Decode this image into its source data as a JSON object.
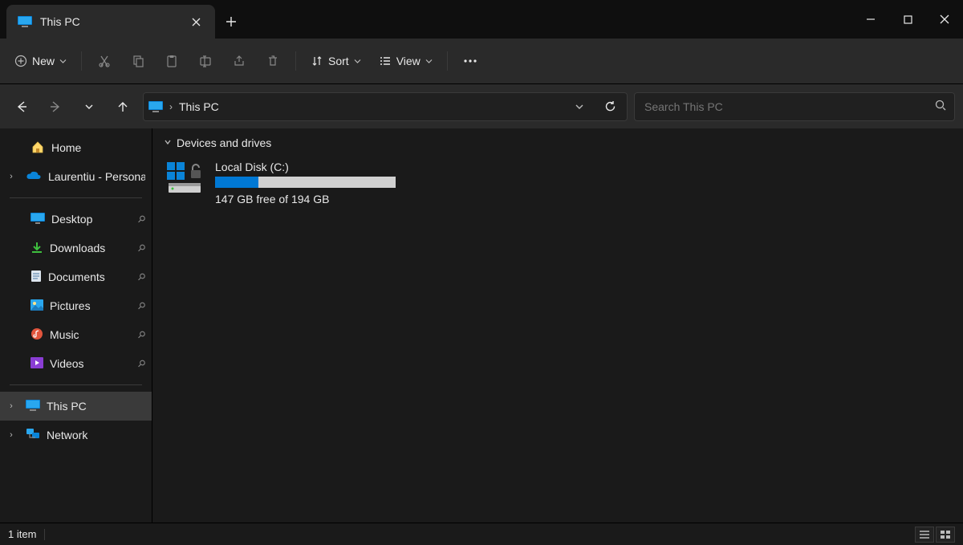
{
  "window": {
    "tab_title": "This PC"
  },
  "toolbar": {
    "new_label": "New",
    "sort_label": "Sort",
    "view_label": "View"
  },
  "address": {
    "location": "This PC"
  },
  "search": {
    "placeholder": "Search This PC"
  },
  "sidebar": {
    "home": "Home",
    "onedrive": "Laurentiu - Personal",
    "pinned": [
      {
        "label": "Desktop"
      },
      {
        "label": "Downloads"
      },
      {
        "label": "Documents"
      },
      {
        "label": "Pictures"
      },
      {
        "label": "Music"
      },
      {
        "label": "Videos"
      }
    ],
    "this_pc": "This PC",
    "network": "Network"
  },
  "main": {
    "group_header": "Devices and drives",
    "drive": {
      "name": "Local Disk (C:)",
      "free_text": "147 GB free of 194 GB",
      "used_percent": 24
    }
  },
  "status": {
    "count_text": "1 item"
  }
}
